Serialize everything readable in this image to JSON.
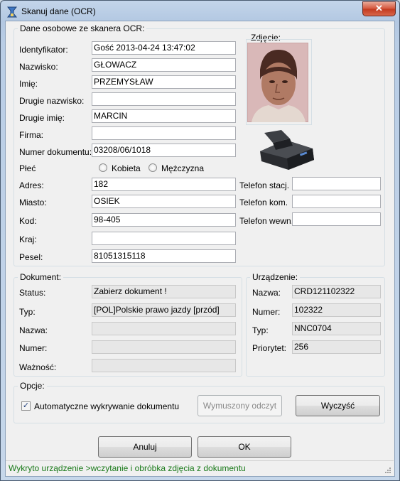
{
  "window": {
    "title": "Skanuj dane (OCR)",
    "close_label": "✕"
  },
  "personal": {
    "legend": "Dane osobowe ze skanera OCR:",
    "fields": [
      {
        "label": "Identyfikator:",
        "value": "Gość 2013-04-24 13:47:02"
      },
      {
        "label": "Nazwisko:",
        "value": "GŁOWACZ"
      },
      {
        "label": "Imię:",
        "value": "PRZEMYSŁAW"
      },
      {
        "label": "Drugie nazwisko:",
        "value": ""
      },
      {
        "label": "Drugie imię:",
        "value": "MARCIN"
      },
      {
        "label": "Firma:",
        "value": ""
      },
      {
        "label": "Numer dokumentu:",
        "value": "03208/06/1018"
      }
    ],
    "gender_label": "Płeć",
    "gender_female": "Kobieta",
    "gender_male": "Mężczyzna",
    "address_fields": [
      {
        "label": "Adres:",
        "value": "182"
      },
      {
        "label": "Miasto:",
        "value": "OSIEK"
      },
      {
        "label": "Kod:",
        "value": "98-405"
      },
      {
        "label": "Kraj:",
        "value": ""
      },
      {
        "label": "Pesel:",
        "value": "81051315118"
      }
    ],
    "photo_label": "Zdjęcie:",
    "phones": [
      {
        "label": "Telefon stacj.",
        "value": ""
      },
      {
        "label": "Telefon kom.",
        "value": ""
      },
      {
        "label": "Telefon wewn.",
        "value": ""
      }
    ]
  },
  "document": {
    "legend": "Dokument:",
    "fields": [
      {
        "label": "Status:",
        "value": "Zabierz dokument !"
      },
      {
        "label": "Typ:",
        "value": "[POL]Polskie prawo jazdy [przód]"
      },
      {
        "label": "Nazwa:",
        "value": ""
      },
      {
        "label": "Numer:",
        "value": ""
      },
      {
        "label": "Ważność:",
        "value": ""
      }
    ]
  },
  "device": {
    "legend": "Urządzenie:",
    "fields": [
      {
        "label": "Nazwa:",
        "value": "CRD121102322"
      },
      {
        "label": "Numer:",
        "value": "102322"
      },
      {
        "label": "Typ:",
        "value": "NNC0704"
      },
      {
        "label": "Priorytet:",
        "value": "256"
      }
    ]
  },
  "options": {
    "legend": "Opcje:",
    "auto_detect_label": "Automatyczne wykrywanie dokumentu",
    "auto_detect_checked": true,
    "forced_read_label": "Wymuszony odczyt",
    "clear_label": "Wyczyść"
  },
  "buttons": {
    "cancel": "Anuluj",
    "ok": "OK"
  },
  "status": {
    "text": "Wykryto urządzenie  >wczytanie i obróbka zdjęcia z dokumentu"
  }
}
